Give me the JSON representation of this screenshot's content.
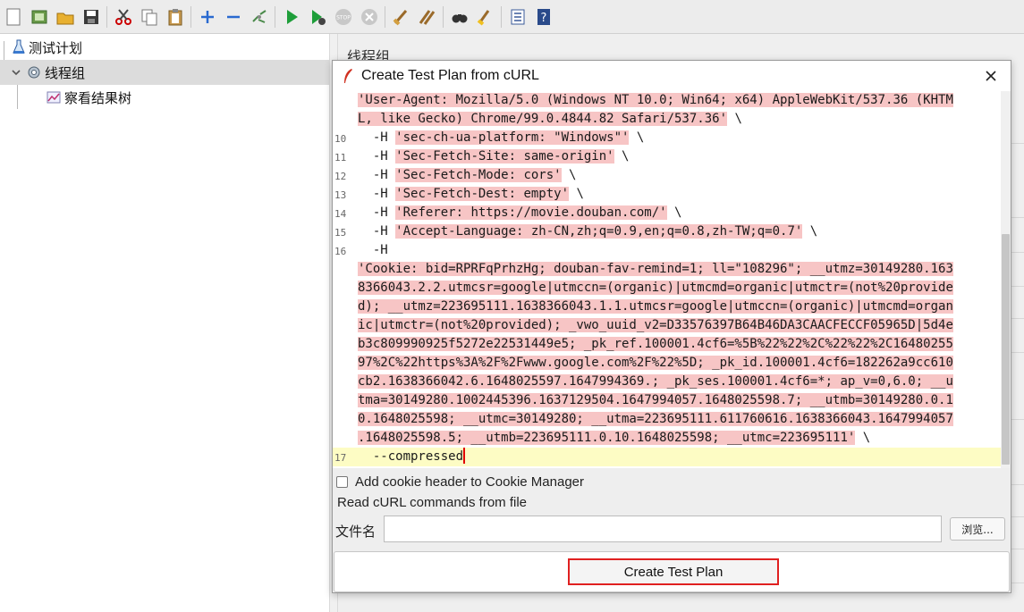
{
  "toolbar": {
    "icons": [
      "new-icon",
      "templates-icon",
      "open-icon",
      "save-icon",
      "cut-icon",
      "copy-icon",
      "paste-icon",
      "expand-icon",
      "collapse-icon",
      "toggle-icon",
      "start-icon",
      "start-no-pause-icon",
      "stop-icon",
      "shutdown-icon",
      "clear-icon",
      "clear-all-icon",
      "search-icon",
      "reset-search-icon",
      "function-helper-icon",
      "help-icon"
    ]
  },
  "tree": {
    "items": [
      {
        "label": "测试计划",
        "icon": "test-plan-icon"
      },
      {
        "label": "线程组",
        "icon": "thread-group-icon"
      },
      {
        "label": "察看结果树",
        "icon": "results-tree-icon"
      }
    ]
  },
  "right_panel": {
    "title": "线程组"
  },
  "dialog": {
    "title": "Create Test Plan from cURL",
    "code_lines": [
      {
        "num": "",
        "text": "'User-Agent: Mozilla/5.0 (Windows NT 10.0; Win64; x64) AppleWebKit/537.36 (KHTM"
      },
      {
        "num": "",
        "text": "L, like Gecko) Chrome/99.0.4844.82 Safari/537.36' \\"
      },
      {
        "num": "10",
        "text": "  -H 'sec-ch-ua-platform: \"Windows\"' \\"
      },
      {
        "num": "11",
        "text": "  -H 'Sec-Fetch-Site: same-origin' \\"
      },
      {
        "num": "12",
        "text": "  -H 'Sec-Fetch-Mode: cors' \\"
      },
      {
        "num": "13",
        "text": "  -H 'Sec-Fetch-Dest: empty' \\"
      },
      {
        "num": "14",
        "text": "  -H 'Referer: https://movie.douban.com/' \\"
      },
      {
        "num": "15",
        "text": "  -H 'Accept-Language: zh-CN,zh;q=0.9,en;q=0.8,zh-TW;q=0.7' \\"
      },
      {
        "num": "16",
        "text": "  -H"
      },
      {
        "num": "",
        "text": "'Cookie: bid=RPRFqPrhzHg; douban-fav-remind=1; ll=\"108296\"; __utmz=30149280.163"
      },
      {
        "num": "",
        "text": "8366043.2.2.utmcsr=google|utmccn=(organic)|utmcmd=organic|utmctr=(not%20provide"
      },
      {
        "num": "",
        "text": "d); __utmz=223695111.1638366043.1.1.utmcsr=google|utmccn=(organic)|utmcmd=organ"
      },
      {
        "num": "",
        "text": "ic|utmctr=(not%20provided); _vwo_uuid_v2=D33576397B64B46DA3CAACFECCF05965D|5d4e"
      },
      {
        "num": "",
        "text": "b3c809990925f5272e22531449e5; _pk_ref.100001.4cf6=%5B%22%22%2C%22%22%2C16480255"
      },
      {
        "num": "",
        "text": "97%2C%22https%3A%2F%2Fwww.google.com%2F%22%5D; _pk_id.100001.4cf6=182262a9cc610"
      },
      {
        "num": "",
        "text": "cb2.1638366042.6.1648025597.1647994369.; _pk_ses.100001.4cf6=*; ap_v=0,6.0; __u"
      },
      {
        "num": "",
        "text": "tma=30149280.1002445396.1637129504.1647994057.1648025598.7; __utmb=30149280.0.1"
      },
      {
        "num": "",
        "text": "0.1648025598; __utmc=30149280; __utma=223695111.611760616.1638366043.1647994057"
      },
      {
        "num": "",
        "text": ".1648025598.5; __utmb=223695111.0.10.1648025598; __utmc=223695111' \\"
      },
      {
        "num": "17",
        "text": "  --compressed"
      }
    ],
    "cookie_checkbox_label": "Add cookie header to Cookie Manager",
    "cookie_checked": false,
    "file_group_title": "Read cURL commands from file",
    "file_label": "文件名",
    "file_value": "",
    "browse_label": "浏览...",
    "create_button": "Create Test Plan"
  },
  "colors": {
    "highlight": "#f7c5c5",
    "current_line": "#fdfcc4",
    "create_border": "#e02020",
    "caret": "#e00000"
  }
}
